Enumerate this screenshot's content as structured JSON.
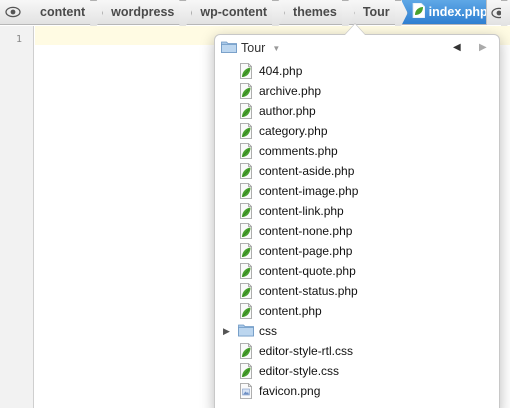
{
  "breadcrumb": {
    "items": [
      "content",
      "wordpress",
      "wp-content",
      "themes",
      "Tour"
    ],
    "active": "index.php"
  },
  "editor": {
    "line_numbers": [
      "1"
    ]
  },
  "popup": {
    "folder": "Tour",
    "items": [
      {
        "label": "404.php",
        "icon": "php-leaf-icon"
      },
      {
        "label": "archive.php",
        "icon": "php-leaf-icon"
      },
      {
        "label": "author.php",
        "icon": "php-leaf-icon"
      },
      {
        "label": "category.php",
        "icon": "php-leaf-icon"
      },
      {
        "label": "comments.php",
        "icon": "php-leaf-icon"
      },
      {
        "label": "content-aside.php",
        "icon": "php-leaf-icon"
      },
      {
        "label": "content-image.php",
        "icon": "php-leaf-icon"
      },
      {
        "label": "content-link.php",
        "icon": "php-leaf-icon"
      },
      {
        "label": "content-none.php",
        "icon": "php-leaf-icon"
      },
      {
        "label": "content-page.php",
        "icon": "php-leaf-icon"
      },
      {
        "label": "content-quote.php",
        "icon": "php-leaf-icon"
      },
      {
        "label": "content-status.php",
        "icon": "php-leaf-icon"
      },
      {
        "label": "content.php",
        "icon": "php-leaf-icon"
      },
      {
        "label": "css",
        "icon": "folder-icon"
      },
      {
        "label": "editor-style-rtl.css",
        "icon": "css-leaf-icon"
      },
      {
        "label": "editor-style.css",
        "icon": "css-leaf-icon"
      },
      {
        "label": "favicon.png",
        "icon": "image-file-icon"
      }
    ]
  },
  "colors": {
    "accent": "#2f7fd1",
    "leaf_green": "#49a12e",
    "folder_blue": "#8fb7de"
  }
}
